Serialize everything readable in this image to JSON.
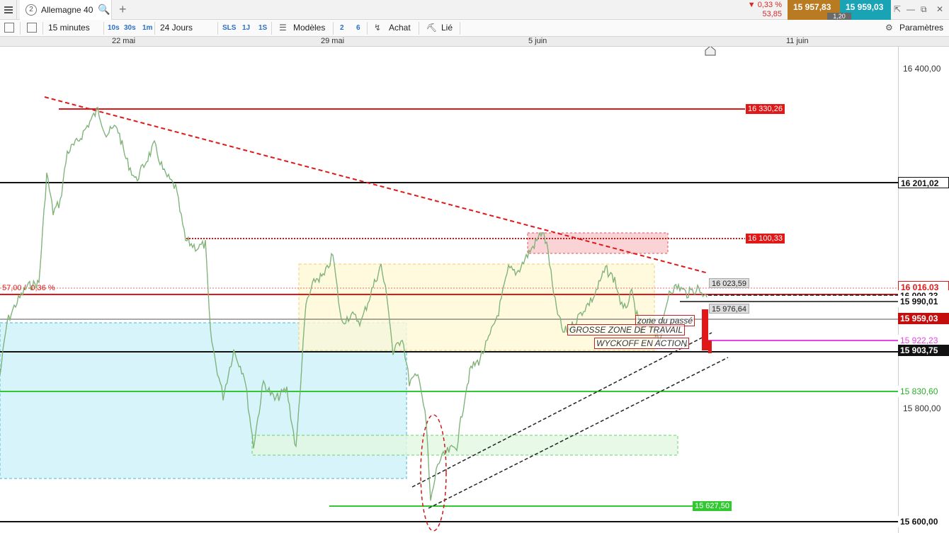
{
  "window": {
    "tab_number": "2",
    "tab_title": "Allemagne 40",
    "search_icon": "magnifier-icon",
    "add_tab_icon": "plus-icon"
  },
  "quote": {
    "change_pct": "▼ 0,33 %",
    "change_abs": "53,85",
    "sell": "15 957,83",
    "buy": "15 959,03",
    "spread": "1,20",
    "sell_color": "#b87b21",
    "buy_color": "#1aa3b5"
  },
  "toolbar": {
    "timeframe": "15 minutes",
    "quick_10s": "10s",
    "quick_30s": "30s",
    "quick_1m": "1m",
    "period": "24 Jours",
    "sls": "SLS",
    "p1j": "1J",
    "p1s": "1S",
    "models": "Modèles",
    "n2": "2",
    "n6": "6",
    "buy": "Achat",
    "linked": "Lié",
    "settings": "Paramètres"
  },
  "dates": [
    "22 mai",
    "29 mai",
    "5 juin",
    "11 juin"
  ],
  "axis": {
    "ticks": [
      "16 400,00",
      "15 800,00",
      "15 600,00"
    ]
  },
  "levels": {
    "resistance_top": "16 330,26",
    "black_1": "16 201,02",
    "dotted_red": "16 100,33",
    "ref_line": "16 016,03",
    "l_16000": "16 000,23",
    "l_15990": "15 990,01",
    "current": "15 959,03",
    "magenta": "15 922,23",
    "black_2": "15 903,75",
    "green_1": "15 830,60",
    "green_low": "15 627,50",
    "label_16023": "16 023,59",
    "label_15976": "15 976,64",
    "ref_text": "57,00 / -0,36 %"
  },
  "notes": {
    "zone_passe": "zone du passé",
    "grosse_zone": "GROSSE ZONE DE TRAVAIL",
    "wyckoff": "WYCKOFF EN ACTION"
  },
  "colors": {
    "red_level": "#e01818",
    "green_level": "#32c832",
    "magenta_level": "#e845e8",
    "teal_zone": "#c8f0f8",
    "yellow_zone": "#fff8d6",
    "pink_zone": "#f8c8cc"
  }
}
